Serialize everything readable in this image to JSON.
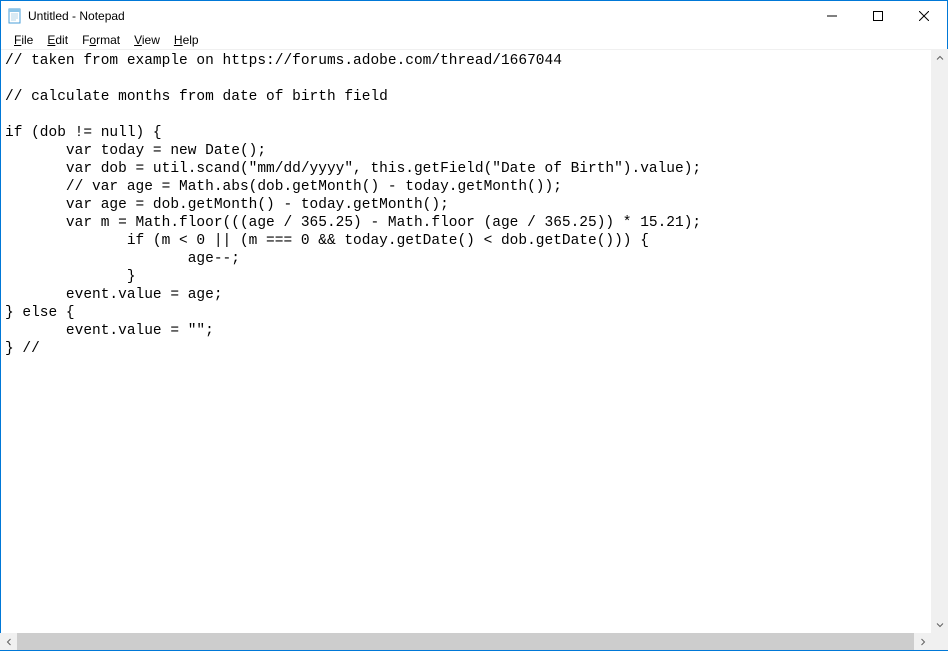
{
  "titlebar": {
    "title": "Untitled - Notepad"
  },
  "menubar": {
    "file": "File",
    "edit": "Edit",
    "format": "Format",
    "view": "View",
    "help": "Help"
  },
  "editor": {
    "content": "// taken from example on https://forums.adobe.com/thread/1667044\n\n// calculate months from date of birth field\n\nif (dob != null) {\n       var today = new Date();\n       var dob = util.scand(\"mm/dd/yyyy\", this.getField(\"Date of Birth\").value);\n       // var age = Math.abs(dob.getMonth() - today.getMonth());\n       var age = dob.getMonth() - today.getMonth();\n       var m = Math.floor(((age / 365.25) - Math.floor (age / 365.25)) * 15.21);\n              if (m < 0 || (m === 0 && today.getDate() < dob.getDate())) {\n                     age--;\n              }\n       event.value = age;\n} else {\n       event.value = \"\";\n} //"
  }
}
